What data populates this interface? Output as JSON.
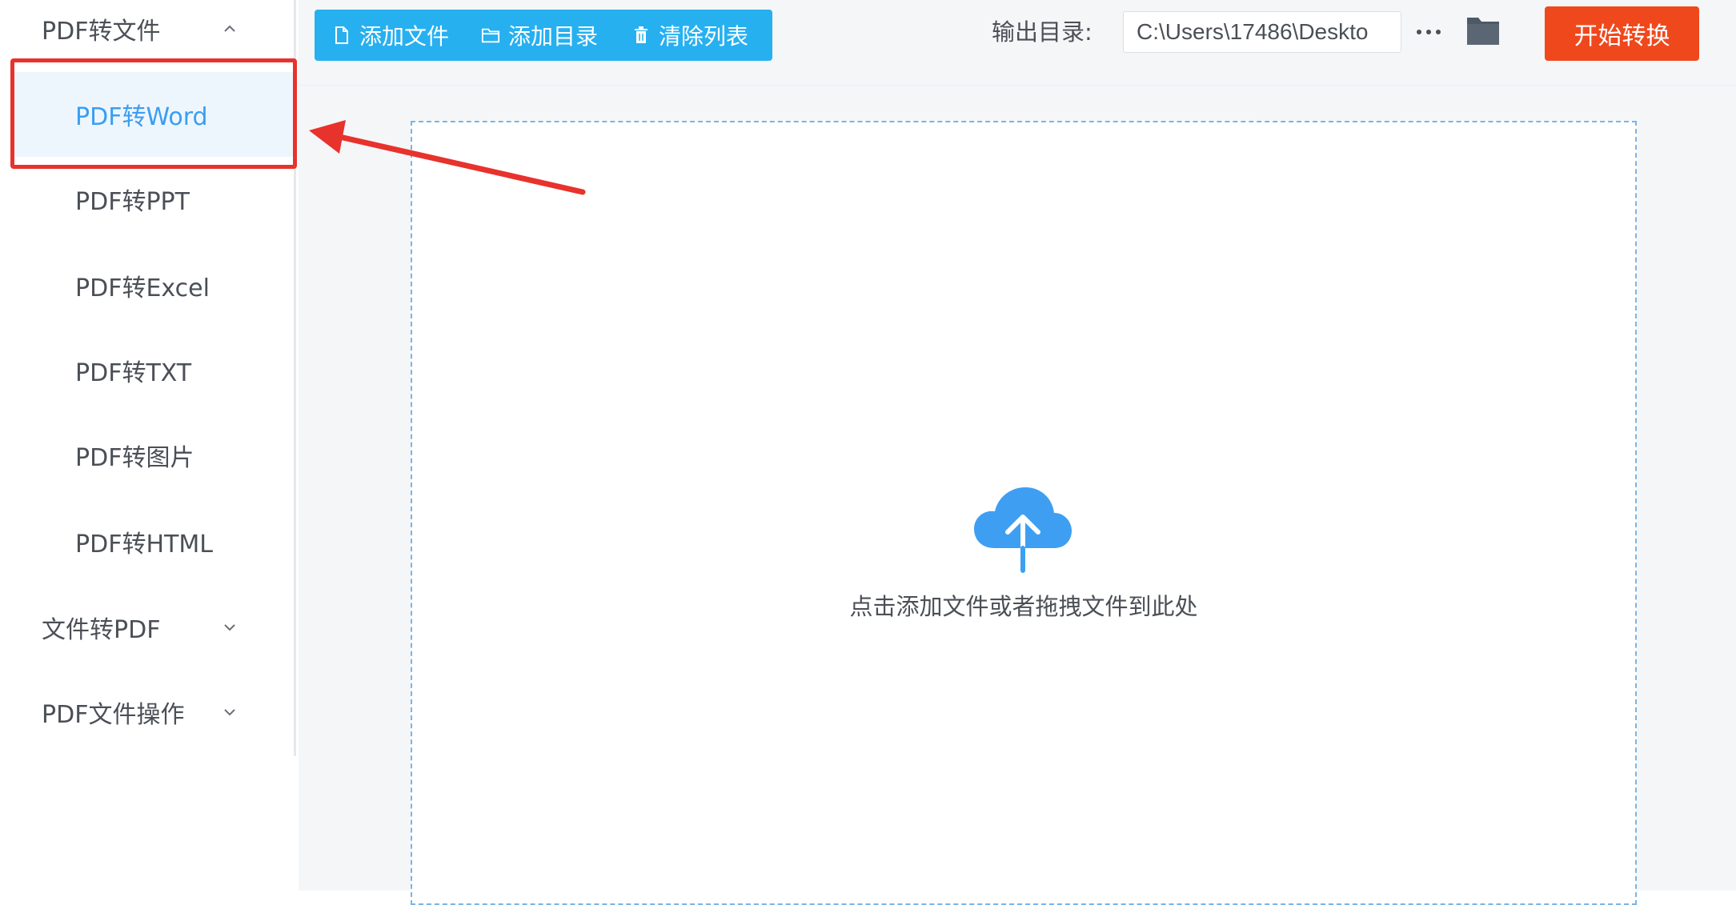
{
  "sidebar": {
    "groups": [
      {
        "label": "PDF转文件",
        "expanded": true,
        "items": [
          {
            "label": "PDF转Word",
            "active": true
          },
          {
            "label": "PDF转PPT"
          },
          {
            "label": "PDF转Excel"
          },
          {
            "label": "PDF转TXT"
          },
          {
            "label": "PDF转图片"
          },
          {
            "label": "PDF转HTML"
          }
        ]
      },
      {
        "label": "文件转PDF",
        "expanded": false
      },
      {
        "label": "PDF文件操作",
        "expanded": false
      }
    ]
  },
  "toolbar": {
    "add_file_label": "添加文件",
    "add_folder_label": "添加目录",
    "clear_list_label": "清除列表",
    "output_label": "输出目录:",
    "output_path": "C:\\Users\\17486\\Deskto",
    "more_label": "···",
    "start_label": "开始转换"
  },
  "drop_zone": {
    "text": "点击添加文件或者拖拽文件到此处"
  },
  "colors": {
    "accent_blue": "#27b0f0",
    "active_text": "#3a9ef2",
    "start_button": "#f0481d",
    "annotation_red": "#e8322c"
  },
  "icons": {
    "add_file": "file-icon",
    "add_folder": "folder-outline-icon",
    "clear_list": "trash-icon",
    "browse": "folder-icon",
    "upload": "cloud-upload-icon"
  }
}
